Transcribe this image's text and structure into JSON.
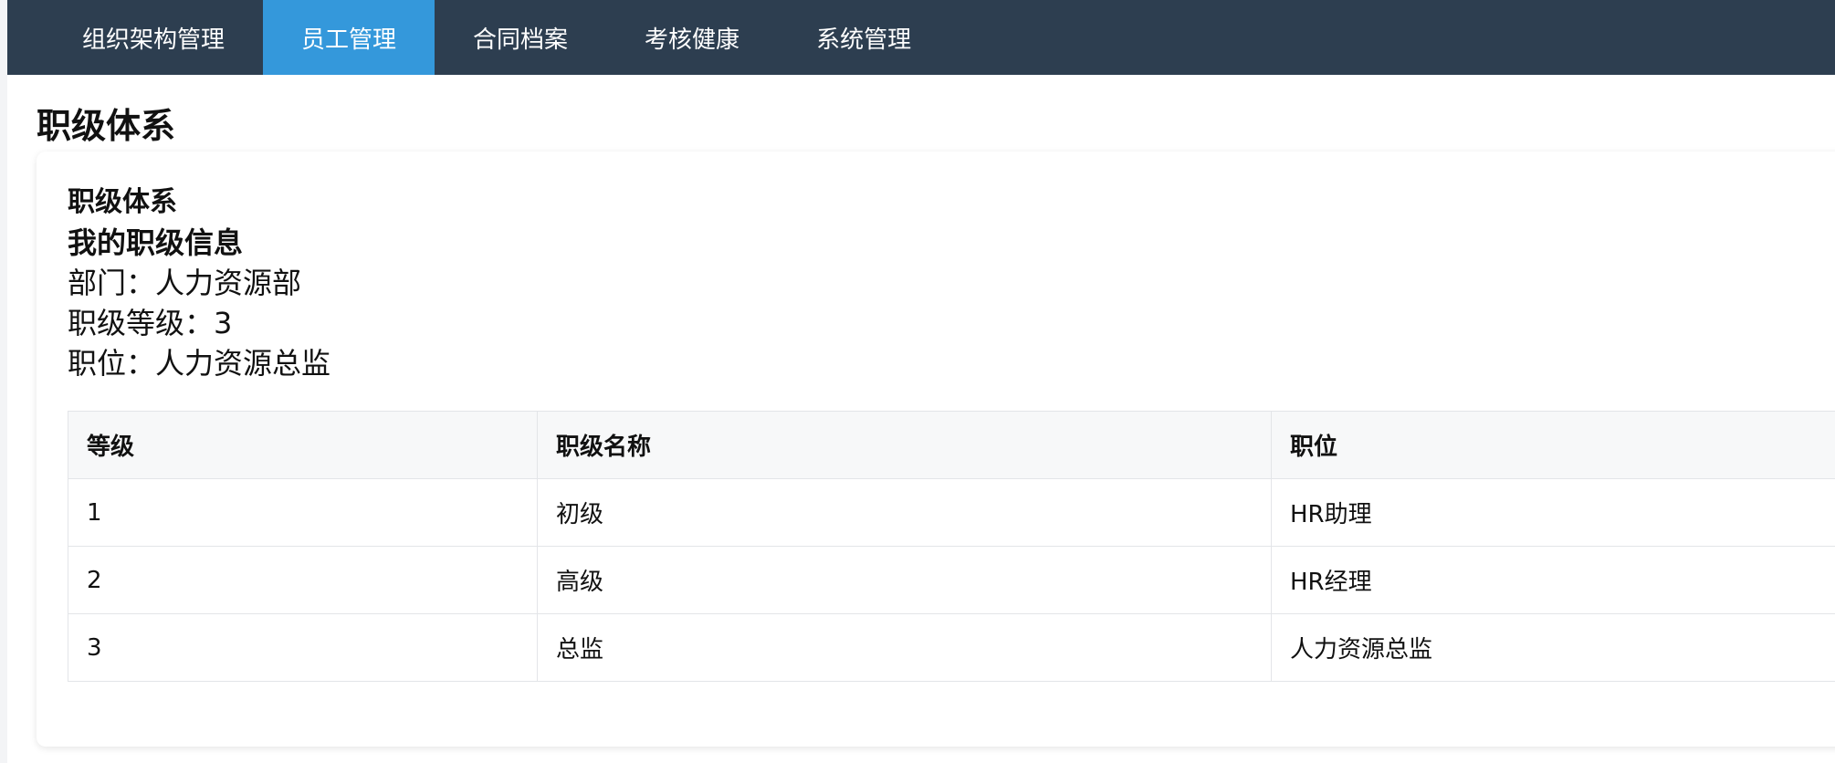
{
  "nav": {
    "items": [
      {
        "label": "组织架构管理",
        "active": false
      },
      {
        "label": "员工管理",
        "active": true
      },
      {
        "label": "合同档案",
        "active": false
      },
      {
        "label": "考核健康",
        "active": false
      },
      {
        "label": "系统管理",
        "active": false
      }
    ]
  },
  "page": {
    "title": "职级体系"
  },
  "card": {
    "title": "职级体系",
    "section_title": "我的职级信息",
    "info": {
      "department": "部门：人力资源部",
      "grade_level": "职级等级：3",
      "position": "职位：人力资源总监"
    }
  },
  "table": {
    "headers": [
      "等级",
      "职级名称",
      "职位"
    ],
    "rows": [
      [
        "1",
        "初级",
        "HR助理"
      ],
      [
        "2",
        "高级",
        "HR经理"
      ],
      [
        "3",
        "总监",
        "人力资源总监"
      ]
    ]
  },
  "colors": {
    "nav_bg": "#2d3e50",
    "nav_active": "#3498db"
  }
}
